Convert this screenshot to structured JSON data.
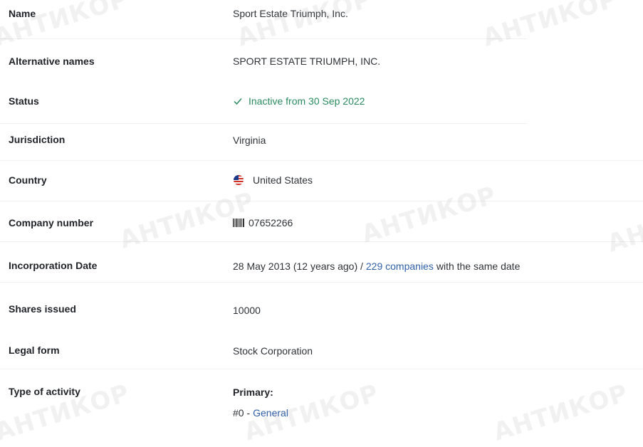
{
  "rows": {
    "name": {
      "label": "Name",
      "value": "Sport Estate Triumph, Inc."
    },
    "alt_names": {
      "label": "Alternative names",
      "value": "SPORT ESTATE TRIUMPH, INC."
    },
    "status": {
      "label": "Status",
      "value": "Inactive from 30 Sep 2022"
    },
    "jurisdiction": {
      "label": "Jurisdiction",
      "value": "Virginia"
    },
    "country": {
      "label": "Country",
      "value": "United States",
      "icon": "us-flag-icon"
    },
    "company_number": {
      "label": "Company number",
      "value": "07652266",
      "icon": "barcode-icon"
    },
    "incorporation_date": {
      "label": "Incorporation Date",
      "value_prefix": "28 May 2013 (12 years ago) /",
      "link_text": "229 companies",
      "value_suffix": "with the same date"
    },
    "shares_issued": {
      "label": "Shares issued",
      "value": "10000"
    },
    "legal_form": {
      "label": "Legal form",
      "value": "Stock Corporation"
    },
    "activity": {
      "label": "Type of activity",
      "primary_label": "Primary:",
      "code": "#0 -",
      "code_link": "General"
    }
  },
  "watermark": {
    "text": "АНТИКОР"
  },
  "colors": {
    "status_green": "#2a8a5f",
    "link_blue": "#2f5fa8",
    "separator": "#eef0f3"
  }
}
